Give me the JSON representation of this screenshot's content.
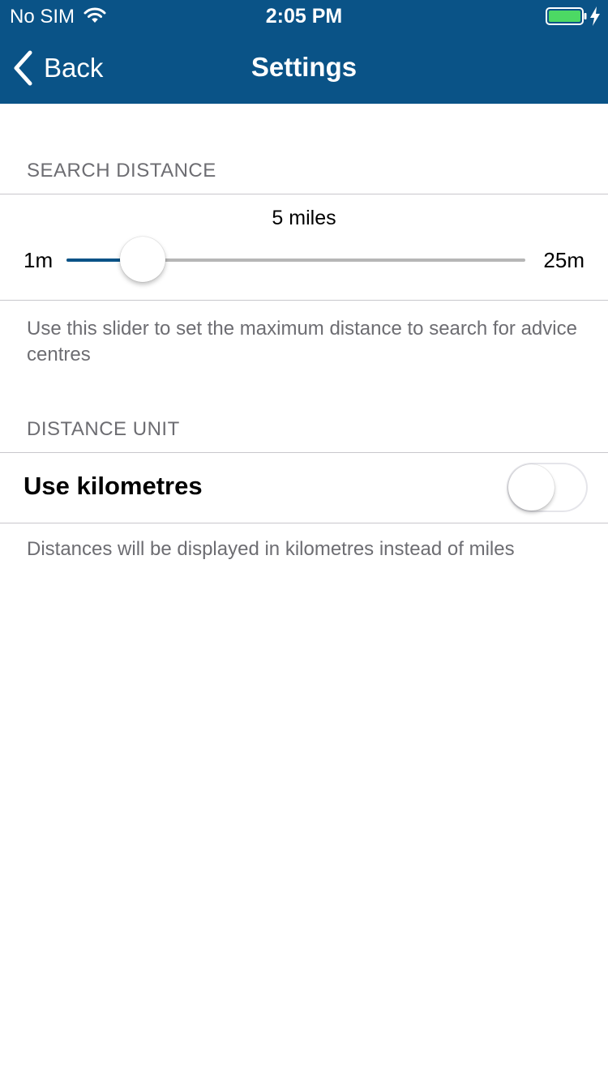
{
  "status_bar": {
    "carrier": "No SIM",
    "time": "2:05 PM",
    "battery_color": "#4cd964"
  },
  "nav": {
    "back_label": "Back",
    "title": "Settings",
    "background": "#0a5387"
  },
  "search_distance": {
    "header": "SEARCH DISTANCE",
    "value_label": "5 miles",
    "min_label": "1m",
    "max_label": "25m",
    "min": 1,
    "max": 25,
    "value": 5,
    "footer": "Use this slider to set the maximum distance to search for advice centres"
  },
  "distance_unit": {
    "header": "DISTANCE UNIT",
    "toggle_label": "Use kilometres",
    "toggle_on": false,
    "footer": "Distances will be displayed in kilometres instead of miles"
  }
}
